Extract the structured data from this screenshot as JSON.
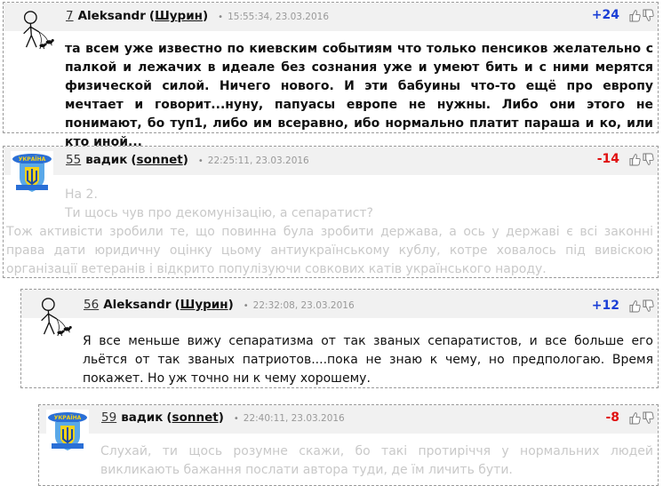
{
  "comments": [
    {
      "number": "7",
      "author": "Aleksandr",
      "nick": "Шурин",
      "timestamp": "15:55:34, 23.03.2016",
      "rating": "+24",
      "avatar_icon": "stick-figure-with-dogs-icon",
      "body": "та всем уже известно по киевским событиям что только пенсиков желательно с палкой и лежачих в идеале без сознания уже и умеют бить и с ними мерятся физической силой. Ничего нового. И эти бабуины что-то ещё про европу мечтает и говорит...нуну, папуасы европе не нужны. Либо они этого не понимают, бо туп1, либо им всеравно, ибо нормально платит параша и ко, или кто иной..."
    },
    {
      "number": "55",
      "author": "вадик",
      "nick": "sonnet",
      "timestamp": "22:25:11, 23.03.2016",
      "rating": "-14",
      "avatar_icon": "ukraine-trident-shield-icon",
      "body_lines": [
        "На 2.",
        "Ти щось чув про декомунізацію, а сепаратист?"
      ],
      "body": "Тож активісти зробили те, що повинна була зробити держава, а ось у державі є всі законні права дати юридичну оцінку цьому антиукраїнському кублу, котре ховалось під вивіскою організації ветеранів і відкрито популізуючи совкових катів українського народу."
    },
    {
      "number": "56",
      "author": "Aleksandr",
      "nick": "Шурин",
      "timestamp": "22:32:08, 23.03.2016",
      "rating": "+12",
      "avatar_icon": "stick-figure-with-dogs-icon",
      "body": "Я все меньше вижу сепаратизма от так званых сепаратистов, и все больше его льётся от так званых патриотов....пока не знаю к чему, но предпологаю. Время покажет. Но уж точно ни к чему хорошему."
    },
    {
      "number": "59",
      "author": "вадик",
      "nick": "sonnet",
      "timestamp": "22:40:11, 23.03.2016",
      "rating": "-8",
      "avatar_icon": "ukraine-trident-shield-icon",
      "body": "Слухай, ти щось розумне скажи, бо такі протиріччя у нормальних людей викликають бажання послати автора туди, де їм личить бути."
    }
  ],
  "vote_icons": {
    "up": "thumbs-up-icon",
    "down": "thumbs-down-icon"
  },
  "colors": {
    "positive": "#1a3fd6",
    "negative": "#e01010",
    "faded_text": "#c9c9c9"
  }
}
